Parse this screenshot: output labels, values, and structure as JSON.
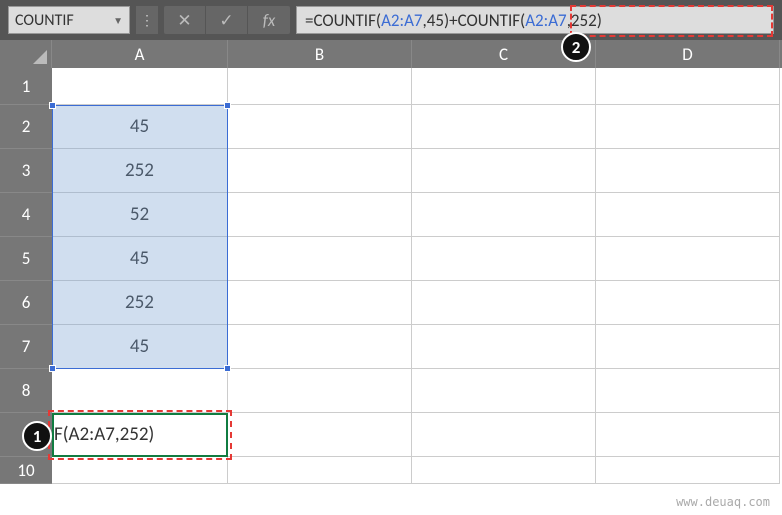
{
  "toolbar": {
    "name_box": "COUNTIF",
    "cancel_icon": "✕",
    "confirm_icon": "✓",
    "fx_icon": "fx",
    "formula_prefix": "=COUNTIF(",
    "formula_ref1": "A2:A7",
    "formula_mid1": ",45)+COUNTIF(",
    "formula_ref2": "A2:A7",
    "formula_mid2": ",252)"
  },
  "columns": [
    "A",
    "B",
    "C",
    "D"
  ],
  "rows": {
    "labels": [
      "1",
      "2",
      "3",
      "4",
      "5",
      "6",
      "7",
      "8",
      "9",
      "10"
    ],
    "colA": {
      "r1": "",
      "r2": "45",
      "r3": "252",
      "r4": "52",
      "r5": "45",
      "r6": "252",
      "r7": "45",
      "r8": "",
      "r9": "F(A2:A7,252)",
      "r10": ""
    }
  },
  "callouts": {
    "one": "1",
    "two": "2"
  },
  "watermark": "www.deuaq.com"
}
